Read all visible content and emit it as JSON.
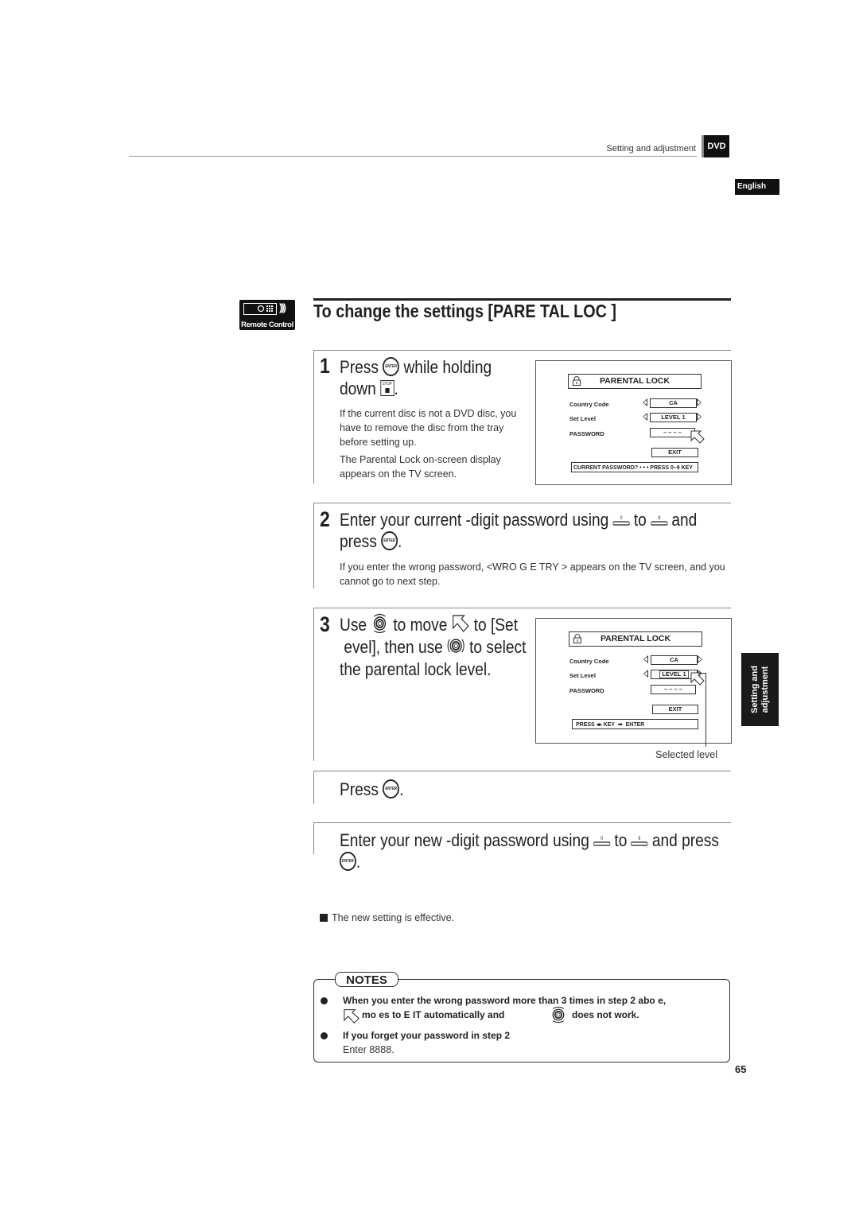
{
  "header": {
    "section": "Setting and adjustment",
    "badge": "DVD",
    "language": "English"
  },
  "remote_badge": {
    "label": "Remote Control",
    "icon": "remote-control-icon"
  },
  "title": "To change the settings [PARE   TAL LOC   ]",
  "steps": [
    {
      "number": "1",
      "head_parts": [
        "Press",
        "while holding",
        "down",
        "."
      ],
      "icons": [
        "enter-button-icon",
        "stop-button-icon"
      ],
      "body": [
        "If the current disc is not a DVD disc, you have to remove the disc from the tray before setting up.",
        "The Parental Lock on-screen display appears on the TV screen."
      ]
    },
    {
      "number": "2",
      "head_parts": [
        "Enter your current   -digit password using",
        "to",
        "and",
        "press",
        "."
      ],
      "icons": [
        "number-0-button-icon",
        "number-9-button-icon",
        "enter-button-icon"
      ],
      "body": [
        "If you enter the wrong password, <WRO   G E   TRY        > appears on the TV screen, and you cannot go to next step."
      ]
    },
    {
      "number": "3",
      "head_parts": [
        "Use",
        "to move",
        "to [Set",
        "evel], then use",
        "to select",
        "the parental lock level."
      ],
      "icons": [
        "joystick-up-down-icon",
        "cursor-icon",
        "joystick-left-right-icon"
      ],
      "callout": "Selected level"
    },
    {
      "number": "",
      "head_parts": [
        "Press",
        "."
      ],
      "icons": [
        "enter-button-icon"
      ]
    },
    {
      "number": "",
      "head_parts": [
        "Enter your new   -digit password using",
        "to",
        "and press",
        "."
      ],
      "icons": [
        "number-0-button-icon",
        "number-9-button-icon",
        "enter-button-icon"
      ]
    }
  ],
  "screen1": {
    "title": "PARENTAL LOCK",
    "rows": [
      {
        "label": "Country Code",
        "value": "CA"
      },
      {
        "label": "Set Level",
        "value": "LEVEL 1"
      },
      {
        "label": "PASSWORD",
        "value": "– – – –"
      }
    ],
    "exit": "EXIT",
    "status": "CURRENT PASSWORD? • • • PRESS 0–9 KEY"
  },
  "screen2": {
    "title": "PARENTAL LOCK",
    "rows": [
      {
        "label": "Country Code",
        "value": "CA"
      },
      {
        "label": "Set Level",
        "value": "LEVEL 1"
      },
      {
        "label": "PASSWORD",
        "value": "– – – –"
      }
    ],
    "exit": "EXIT",
    "status_parts": [
      "PRESS",
      "KEY",
      "ENTER"
    ]
  },
  "result": "The new setting is effective.",
  "notes": {
    "tag": "NOTES",
    "items": [
      {
        "line1": "When you enter the wrong password more than 3 times in step 2 abo  e,",
        "line2_a": "mo  es to   E  IT   automatically and",
        "line2_b": "does not work."
      },
      {
        "line1": "If you forget your password in step 2",
        "line2": "Enter   8888."
      }
    ]
  },
  "side_tab": {
    "line1": "Setting and",
    "line2": "adjustment"
  },
  "page_number": "65"
}
